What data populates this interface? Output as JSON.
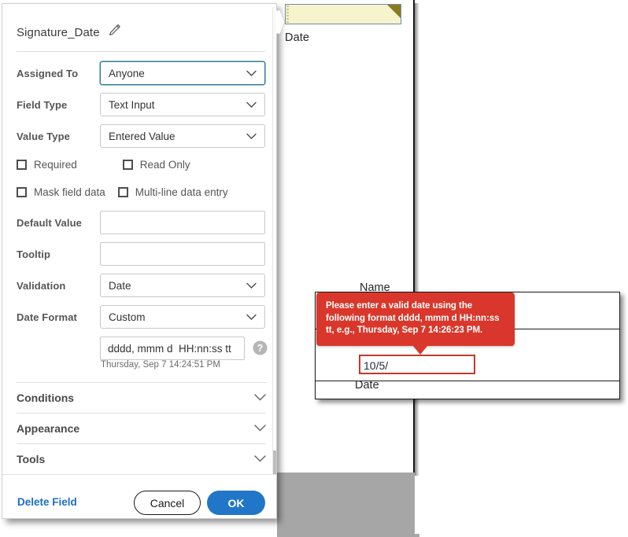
{
  "document": {
    "top_field_label": "Date",
    "overlay": {
      "name_label": "Name",
      "date_value": "10/5/",
      "date_label": "Date"
    }
  },
  "tooltip": {
    "message": "Please enter a valid date using the following format dddd, mmm d HH:nn:ss tt, e.g., Thursday, Sep 7 14:26:23 PM.",
    "color": "#d9372b"
  },
  "dialog": {
    "title": "Signature_Date",
    "edit_icon": "pencil-icon",
    "fields": {
      "assigned_to": {
        "label": "Assigned To",
        "value": "Anyone"
      },
      "field_type": {
        "label": "Field Type",
        "value": "Text Input"
      },
      "value_type": {
        "label": "Value Type",
        "value": "Entered Value"
      },
      "default_value": {
        "label": "Default Value",
        "value": "",
        "placeholder": ""
      },
      "tooltip_field": {
        "label": "Tooltip",
        "value": "",
        "placeholder": ""
      },
      "validation": {
        "label": "Validation",
        "value": "Date"
      },
      "date_format": {
        "label": "Date Format",
        "value": "Custom"
      },
      "custom_format": {
        "value": "dddd, mmm d  HH:nn:ss tt",
        "sample": "Thursday, Sep 7 14:24:51 PM"
      }
    },
    "checkboxes": [
      {
        "label": "Required",
        "checked": false
      },
      {
        "label": "Read Only",
        "checked": false
      },
      {
        "label": "Mask field data",
        "checked": false
      },
      {
        "label": "Multi-line data entry",
        "checked": false
      }
    ],
    "sections": [
      {
        "label": "Conditions"
      },
      {
        "label": "Appearance"
      },
      {
        "label": "Tools"
      }
    ],
    "footer": {
      "delete_label": "Delete Field",
      "cancel_label": "Cancel",
      "ok_label": "OK",
      "ok_color": "#2176c7",
      "link_color": "#1b6ec2"
    }
  }
}
